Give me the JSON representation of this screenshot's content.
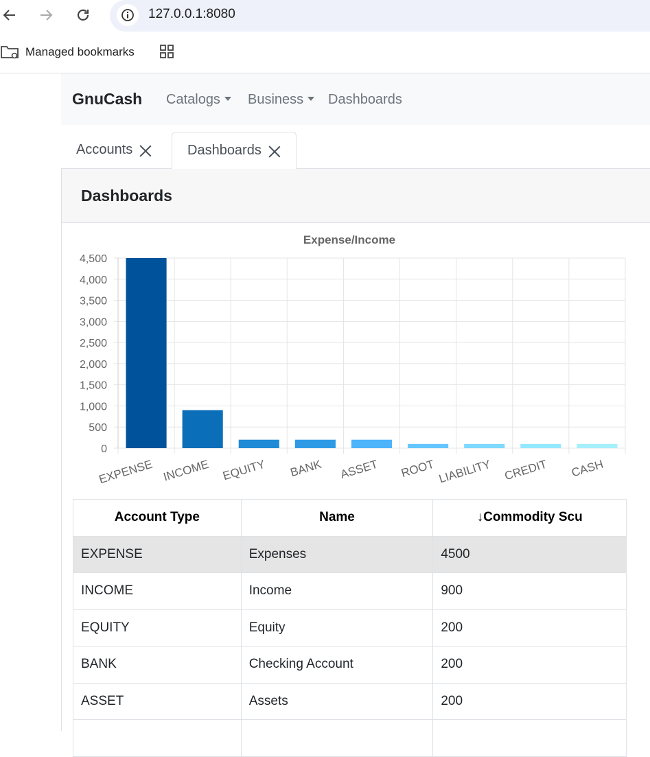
{
  "browser": {
    "url": "127.0.0.1:8080",
    "bookmarks_label": "Managed bookmarks"
  },
  "navbar": {
    "brand": "GnuCash",
    "items": [
      "Catalogs",
      "Business",
      "Dashboards"
    ]
  },
  "tabs": [
    {
      "label": "Accounts",
      "active": false
    },
    {
      "label": "Dashboards",
      "active": true
    }
  ],
  "card": {
    "title": "Dashboards"
  },
  "chart_data": {
    "type": "bar",
    "title": "Expense/Income",
    "categories": [
      "EXPENSE",
      "INCOME",
      "EQUITY",
      "BANK",
      "ASSET",
      "ROOT",
      "LIABILITY",
      "CREDIT",
      "CASH"
    ],
    "values": [
      4500,
      900,
      200,
      200,
      200,
      100,
      100,
      100,
      100
    ],
    "colors": [
      "#00529b",
      "#0a6eb8",
      "#1f8bd6",
      "#2e9ae6",
      "#4db3fb",
      "#66c6ff",
      "#7fd9ff",
      "#94e8ff",
      "#a6f0fb"
    ],
    "yticks": [
      "0",
      "500",
      "1,000",
      "1,500",
      "2,000",
      "2,500",
      "3,000",
      "3,500",
      "4,000",
      "4,500"
    ],
    "ylim": [
      0,
      4500
    ],
    "grid": true,
    "xlabel": "",
    "ylabel": ""
  },
  "table": {
    "headers": [
      "Account Type",
      "Name",
      "↓Commodity Scu"
    ],
    "rows": [
      [
        "EXPENSE",
        "Expenses",
        "4500"
      ],
      [
        "INCOME",
        "Income",
        "900"
      ],
      [
        "EQUITY",
        "Equity",
        "200"
      ],
      [
        "BANK",
        "Checking Account",
        "200"
      ],
      [
        "ASSET",
        "Assets",
        "200"
      ],
      [
        "",
        "",
        ""
      ]
    ]
  }
}
